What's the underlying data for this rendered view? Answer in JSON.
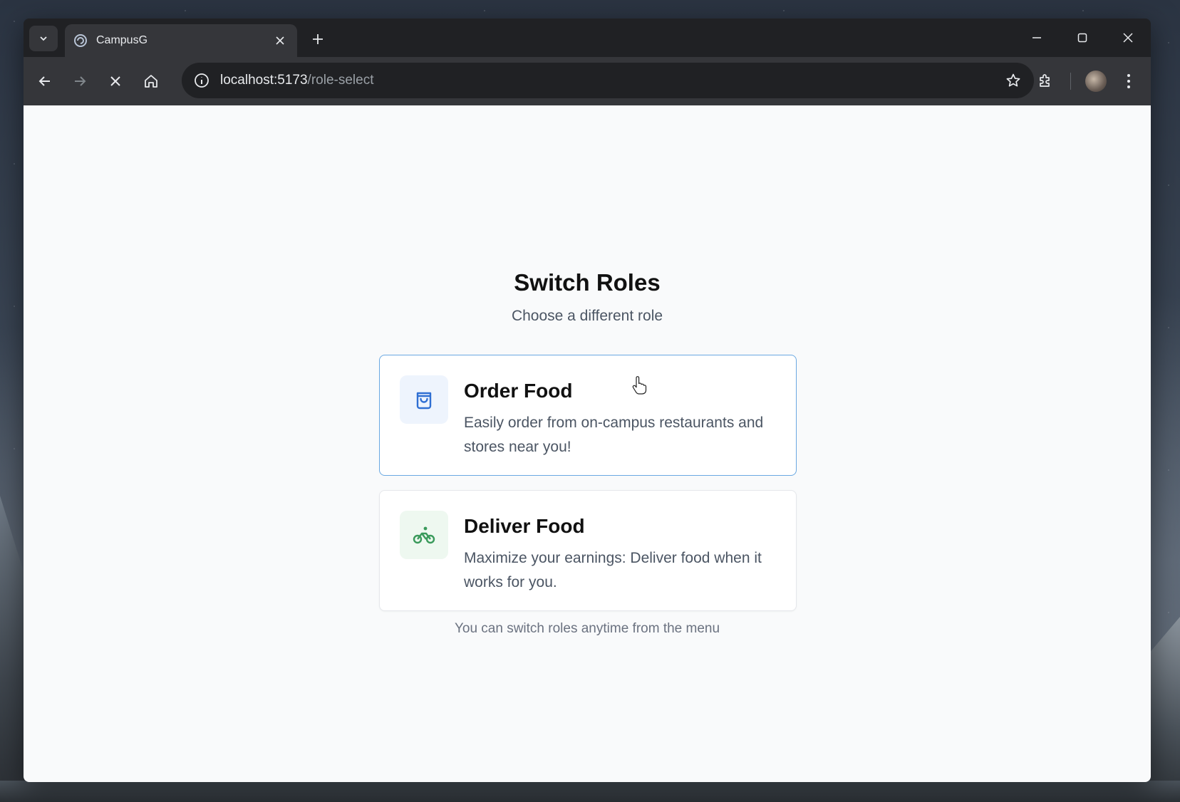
{
  "browser": {
    "tab_title": "CampusG",
    "url_host": "localhost:5173",
    "url_path": "/role-select"
  },
  "page": {
    "title": "Switch Roles",
    "subtitle": "Choose a different role",
    "footnote": "You can switch roles anytime from the menu"
  },
  "roles": [
    {
      "name": "Order Food",
      "description": "Easily order from on-campus restaurants and stores near you!",
      "icon": "shopping-bag-icon",
      "accent": "#2f6fd3"
    },
    {
      "name": "Deliver Food",
      "description": "Maximize your earnings: Deliver food when it works for you.",
      "icon": "bicycle-icon",
      "accent": "#3a9a5b"
    }
  ]
}
